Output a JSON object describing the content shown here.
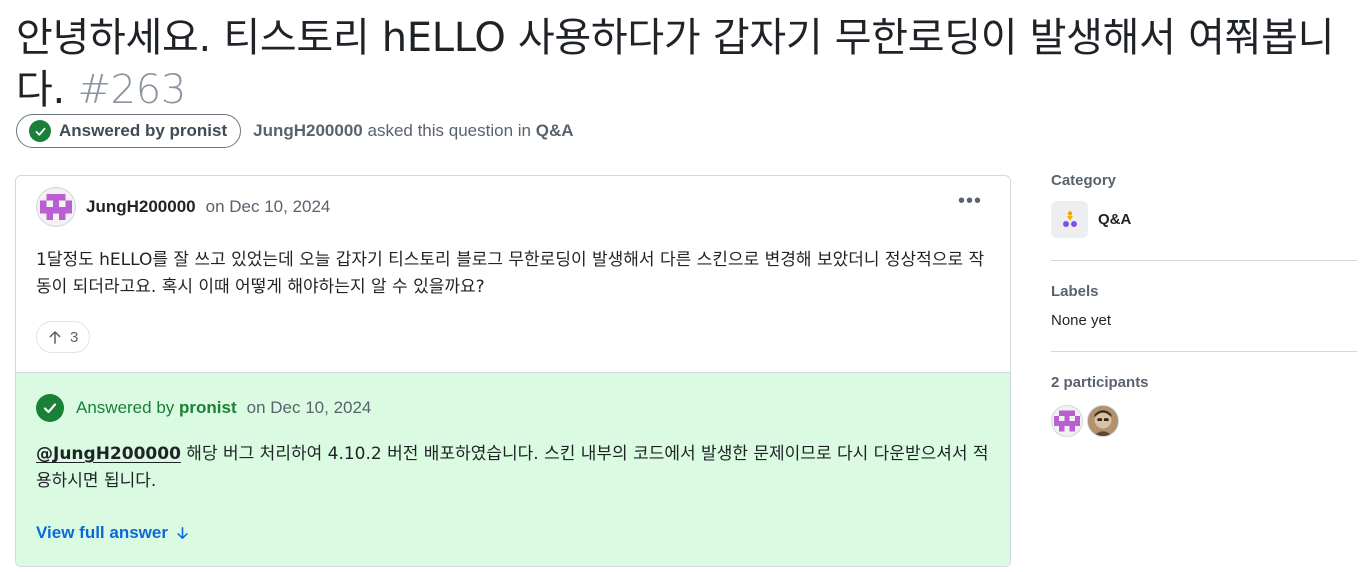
{
  "title": {
    "text": "안녕하세요. 티스토리 hELLO 사용하다가 갑자기 무한로딩이 발생해서 여쭤봅니다.",
    "number": "#263"
  },
  "meta": {
    "answered_pill": "Answered by pronist",
    "asker": "JungH200000",
    "asked_text": "asked this question in",
    "category_link": "Q&A"
  },
  "post": {
    "author": "JungH200000",
    "date": "on Dec 10, 2024",
    "menu_icon": "kebab-horizontal-icon",
    "body": "1달정도 hELLO를 잘 쓰고 있었는데 오늘 갑자기 티스토리 블로그 무한로딩이 발생해서 다른 스킨으로 변경해 보았더니 정상적으로 작동이 되더라고요. 혹시 이때 어떻게 해야하는지 알 수 있을까요?",
    "upvotes": "3"
  },
  "answer": {
    "label": "Answered by",
    "author": "pronist",
    "date": "on Dec 10, 2024",
    "mention": "@JungH200000",
    "body": " 해당 버그 처리하여 4.10.2 버전 배포하였습니다. 스킨 내부의 코드에서 발생한 문제이므로 다시 다운받으셔서 적용하시면 됩니다.",
    "view_full": "View full answer"
  },
  "sidebar": {
    "category_heading": "Category",
    "category_name": "Q&A",
    "labels_heading": "Labels",
    "labels_value": "None yet",
    "participants_heading": "2 participants"
  },
  "colors": {
    "answered_green": "#1a7f37",
    "answer_bg": "#dafbe1",
    "link_blue": "#0969da",
    "identicon_purple": "#b95ed3"
  }
}
